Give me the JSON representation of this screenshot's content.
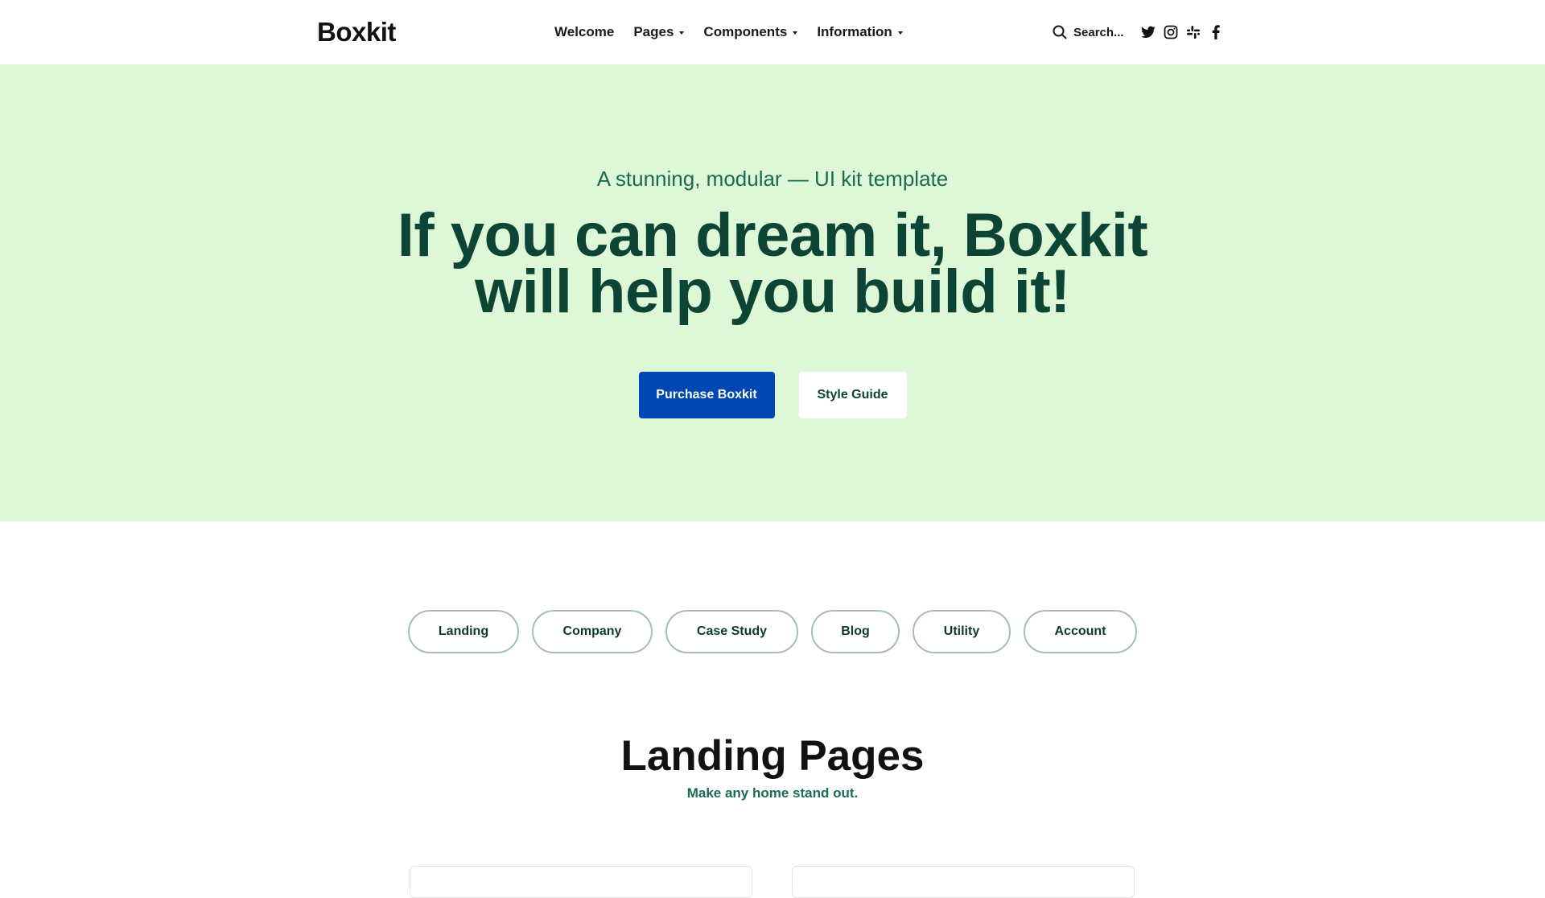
{
  "header": {
    "logo": "Boxkit",
    "nav": [
      {
        "label": "Welcome",
        "has_dropdown": false
      },
      {
        "label": "Pages",
        "has_dropdown": true
      },
      {
        "label": "Components",
        "has_dropdown": true
      },
      {
        "label": "Information",
        "has_dropdown": true
      }
    ],
    "search_label": "Search...",
    "social_icons": [
      "twitter-icon",
      "instagram-icon",
      "slack-icon",
      "facebook-icon"
    ]
  },
  "hero": {
    "kicker": "A stunning, modular — UI kit template",
    "title_line1": "If you can dream it, Boxkit",
    "title_line2": "will help you build it!",
    "primary_button": "Purchase Boxkit",
    "secondary_button": "Style Guide",
    "background_color": "#ddf7d7",
    "primary_color": "#0047b3"
  },
  "filters": [
    {
      "label": "Landing"
    },
    {
      "label": "Company"
    },
    {
      "label": "Case Study"
    },
    {
      "label": "Blog"
    },
    {
      "label": "Utility"
    },
    {
      "label": "Account"
    }
  ],
  "section": {
    "title": "Landing Pages",
    "subtitle": "Make any home stand out."
  }
}
